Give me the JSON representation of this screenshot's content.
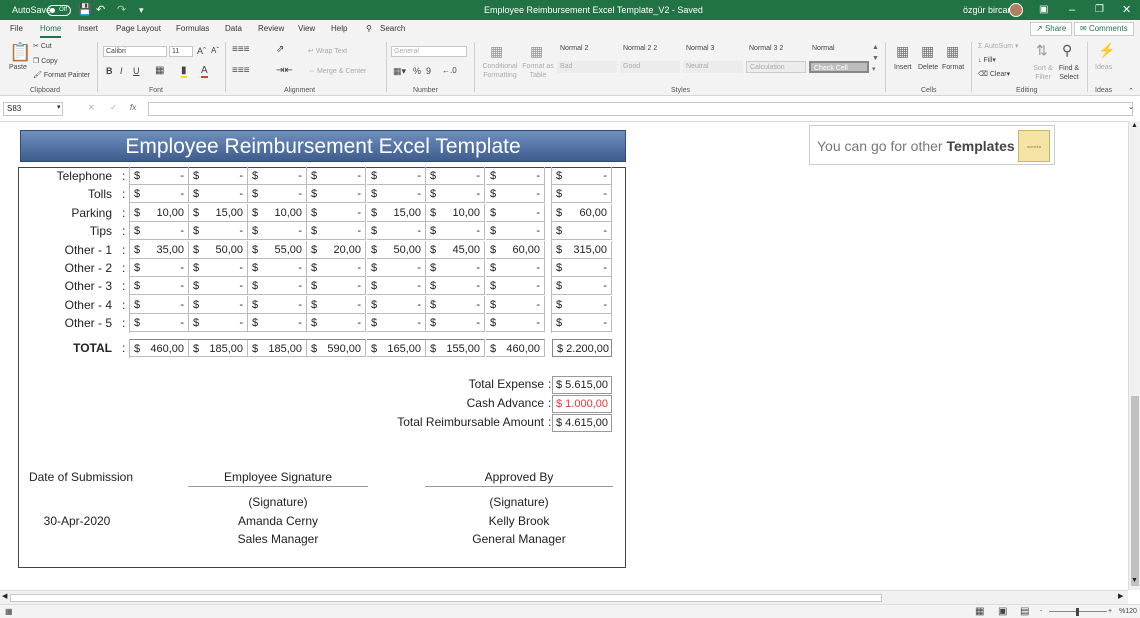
{
  "titlebar": {
    "autosave_label": "AutoSave",
    "autosave_state": "Off",
    "undo_icon": "undo-icon",
    "redo_icon": "redo-icon",
    "title": "Employee  Reimbursement Excel Template_V2  -  Saved",
    "user": "özgür bircan"
  },
  "menubar": {
    "tabs": [
      "File",
      "Home",
      "Insert",
      "Page Layout",
      "Formulas",
      "Data",
      "Review",
      "View",
      "Help"
    ],
    "active_tab": "Home",
    "search": "Search",
    "share": "Share",
    "comments": "Comments"
  },
  "ribbon": {
    "clipboard": {
      "paste": "Paste",
      "cut": "Cut",
      "copy": "Copy",
      "format_painter": "Format Painter",
      "group": "Clipboard"
    },
    "font": {
      "name": "Calibri",
      "size": "11",
      "bold": "B",
      "italic": "I",
      "underline": "U",
      "group": "Font"
    },
    "alignment": {
      "wrap": "Wrap Text",
      "merge": "Merge & Center",
      "group": "Alignment"
    },
    "number": {
      "format": "General",
      "percent": "%",
      "comma": "9",
      "group": "Number"
    },
    "styles": {
      "conditional": "Conditional Formatting",
      "format_table": "Format as Table",
      "cells": [
        [
          "Normal 2",
          "Normal 2 2",
          "Normal 3",
          "Normal 3 2",
          "Normal"
        ],
        [
          "Bad",
          "Good",
          "Neutral",
          "Calculation",
          "Check Cell"
        ]
      ],
      "group": "Styles"
    },
    "cells": {
      "insert": "Insert",
      "delete": "Delete",
      "format": "Format",
      "group": "Cells"
    },
    "editing": {
      "autosum": "AutoSum",
      "fill": "Fill",
      "clear": "Clear",
      "sort": "Sort & Filter",
      "find": "Find & Select",
      "group": "Editing"
    },
    "ideas": {
      "label": "Ideas",
      "group": "Ideas"
    }
  },
  "formulabar": {
    "namebox": "S83",
    "fx": "fx"
  },
  "sheet": {
    "banner": "Employee  Reimbursement Excel Template",
    "promo": {
      "prefix": "You can go for other ",
      "bold": "Templates",
      "logo": "someka"
    },
    "currency": "$",
    "rows": [
      {
        "label": "Telephone",
        "values": [
          "-",
          "-",
          "-",
          "-",
          "-",
          "-",
          "-"
        ],
        "total": "-"
      },
      {
        "label": "Tolls",
        "values": [
          "-",
          "-",
          "-",
          "-",
          "-",
          "-",
          "-"
        ],
        "total": "-"
      },
      {
        "label": "Parking",
        "values": [
          "10,00",
          "15,00",
          "10,00",
          "-",
          "15,00",
          "10,00",
          "-"
        ],
        "total": "60,00"
      },
      {
        "label": "Tips",
        "values": [
          "-",
          "-",
          "-",
          "-",
          "-",
          "-",
          "-"
        ],
        "total": "-"
      },
      {
        "label": "Other - 1",
        "values": [
          "35,00",
          "50,00",
          "55,00",
          "20,00",
          "50,00",
          "45,00",
          "60,00"
        ],
        "total": "315,00"
      },
      {
        "label": "Other - 2",
        "values": [
          "-",
          "-",
          "-",
          "-",
          "-",
          "-",
          "-"
        ],
        "total": "-"
      },
      {
        "label": "Other - 3",
        "values": [
          "-",
          "-",
          "-",
          "-",
          "-",
          "-",
          "-"
        ],
        "total": "-"
      },
      {
        "label": "Other - 4",
        "values": [
          "-",
          "-",
          "-",
          "-",
          "-",
          "-",
          "-"
        ],
        "total": "-"
      },
      {
        "label": "Other - 5",
        "values": [
          "-",
          "-",
          "-",
          "-",
          "-",
          "-",
          "-"
        ],
        "total": "-"
      }
    ],
    "total_row": {
      "label": "TOTAL",
      "values": [
        "460,00",
        "185,00",
        "185,00",
        "590,00",
        "165,00",
        "155,00",
        "460,00"
      ],
      "total": "$ 2.200,00"
    },
    "summary": [
      {
        "label": "Total Expense",
        "value": "$ 5.615,00",
        "color": "#222222"
      },
      {
        "label": "Cash Advance",
        "value": "$ 1.000,00",
        "color": "#e03a3a"
      },
      {
        "label": "Total Reimbursable Amount",
        "value": "$ 4.615,00",
        "color": "#222222"
      }
    ],
    "signatures": {
      "date_label": "Date of Submission",
      "date": "30-Apr-2020",
      "employee_label": "Employee Signature",
      "employee_sig": "(Signature)",
      "employee_name": "Amanda Cerny",
      "employee_title": "Sales Manager",
      "approver_label": "Approved By",
      "approver_sig": "(Signature)",
      "approver_name": "Kelly Brook",
      "approver_title": "General Manager"
    }
  },
  "statusbar": {
    "zoom": "%120",
    "minus": "-",
    "plus": "+"
  }
}
